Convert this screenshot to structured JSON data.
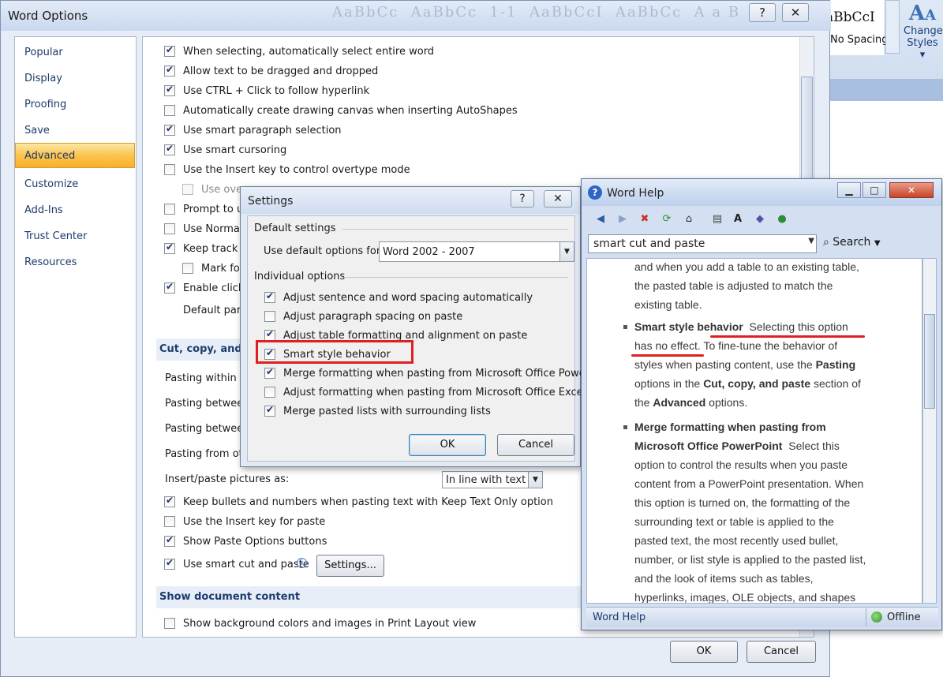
{
  "ribbon": {
    "style_sample": "aBbCcI",
    "style_name": "No Spacing",
    "change_styles_icon": "change-styles-icon",
    "change_styles": "Change",
    "change_styles_2": "Styles ▾"
  },
  "word_options": {
    "title": "Word Options",
    "help": "?",
    "close": "✕",
    "nav": [
      "Popular",
      "Display",
      "Proofing",
      "Save",
      "Advanced",
      "Customize",
      "Add-Ins",
      "Trust Center",
      "Resources"
    ],
    "options_top": [
      {
        "label": "When selecting, automatically select entire word",
        "checked": true
      },
      {
        "label": "Allow text to be dragged and dropped",
        "checked": true
      },
      {
        "label": "Use CTRL + Click to follow hyperlink",
        "checked": true
      },
      {
        "label": "Automatically create drawing canvas when inserting AutoShapes",
        "checked": false
      },
      {
        "label": "Use smart paragraph selection",
        "checked": true
      },
      {
        "label": "Use smart cursoring",
        "checked": true
      },
      {
        "label": "Use the Insert key to control overtype mode",
        "checked": false
      },
      {
        "label": "Use over",
        "checked": false,
        "disabled": true
      },
      {
        "label": "Prompt to up",
        "checked": false
      },
      {
        "label": "Use Normal",
        "checked": false
      },
      {
        "label": "Keep track o",
        "checked": true
      },
      {
        "label": "Mark for",
        "checked": false
      },
      {
        "label": "Enable click a",
        "checked": true
      },
      {
        "label": "Default paragr",
        "checked": null
      }
    ],
    "section_cut": "Cut, copy, and pa",
    "paste_rows": [
      "Pasting within th",
      "Pasting between",
      "Pasting between",
      "Pasting from oth"
    ],
    "insert_pictures_label": "Insert/paste pictures as:",
    "insert_pictures_value": "In line with text",
    "options_bottom": [
      {
        "label": "Keep bullets and numbers when pasting text with Keep Text Only option",
        "checked": true
      },
      {
        "label": "Use the Insert key for paste",
        "checked": false
      },
      {
        "label": "Show Paste Options buttons",
        "checked": true
      },
      {
        "label": "Use smart cut and paste",
        "checked": true
      }
    ],
    "info_icon": "info-icon",
    "settings_button": "Settings...",
    "section_show": "Show document content",
    "show_bg": {
      "label": "Show background colors and images in Print Layout view",
      "checked": false
    },
    "ok": "OK",
    "cancel": "Cancel"
  },
  "settings": {
    "title": "Settings",
    "help": "?",
    "close": "✕",
    "default_group": "Default settings",
    "use_default_label": "Use default options for:",
    "use_default_value": "Word 2002 - 2007",
    "individual_group": "Individual options",
    "options": [
      {
        "label": "Adjust sentence and word spacing automatically",
        "checked": true
      },
      {
        "label": "Adjust paragraph spacing on paste",
        "checked": false
      },
      {
        "label": "Adjust table formatting and alignment on paste",
        "checked": true
      },
      {
        "label": "Smart style behavior",
        "checked": true
      },
      {
        "label": "Merge formatting when pasting from Microsoft Office PowerPoint",
        "checked": true
      },
      {
        "label": "Adjust formatting when pasting from Microsoft Office Excel",
        "checked": false
      },
      {
        "label": "Merge pasted lists with surrounding lists",
        "checked": true
      }
    ],
    "ok": "OK",
    "cancel": "Cancel",
    "highlight_color": "#e02020"
  },
  "help": {
    "title": "Word Help",
    "minimize": "▁",
    "maximize": "□",
    "close": "✕",
    "toolbar_icons": [
      "back-icon",
      "forward-icon",
      "stop-icon",
      "refresh-icon",
      "home-icon",
      "print-icon",
      "text-size-icon",
      "book-icon",
      "pin-icon"
    ],
    "search_value": "smart cut and paste",
    "search_button": "Search",
    "para1": [
      "and when you add a table to an existing table,",
      "the pasted table is adjusted to match the",
      "existing table."
    ],
    "smart_title": "Smart style behavior",
    "smart_text_1": "Selecting this option",
    "smart_text_2": "has no effect.",
    "smart_text_3": "To fine-tune the behavior of",
    "smart_text_4": "styles when pasting content, use the",
    "smart_pasting": "Pasting",
    "smart_text_5": "options in the",
    "smart_cut": "Cut, copy, and paste",
    "smart_text_6": "section of",
    "smart_text_7": "the",
    "smart_adv": "Advanced",
    "smart_text_8": "options.",
    "merge_title_1": "Merge formatting when pasting from",
    "merge_title_2": "Microsoft Office PowerPoint",
    "merge_lines": [
      "Select this",
      "option to control the results when you paste",
      "content from a PowerPoint presentation. When",
      "this option is turned on, the formatting of the",
      "surrounding text or table is applied to the",
      "pasted text, the most recently used bullet,",
      "number, or list style is applied to the pasted list,",
      "and the look of items such as tables,",
      "hyperlinks, images, OLE objects, and shapes"
    ],
    "status_left": "Word Help",
    "status_right": "Offline"
  }
}
